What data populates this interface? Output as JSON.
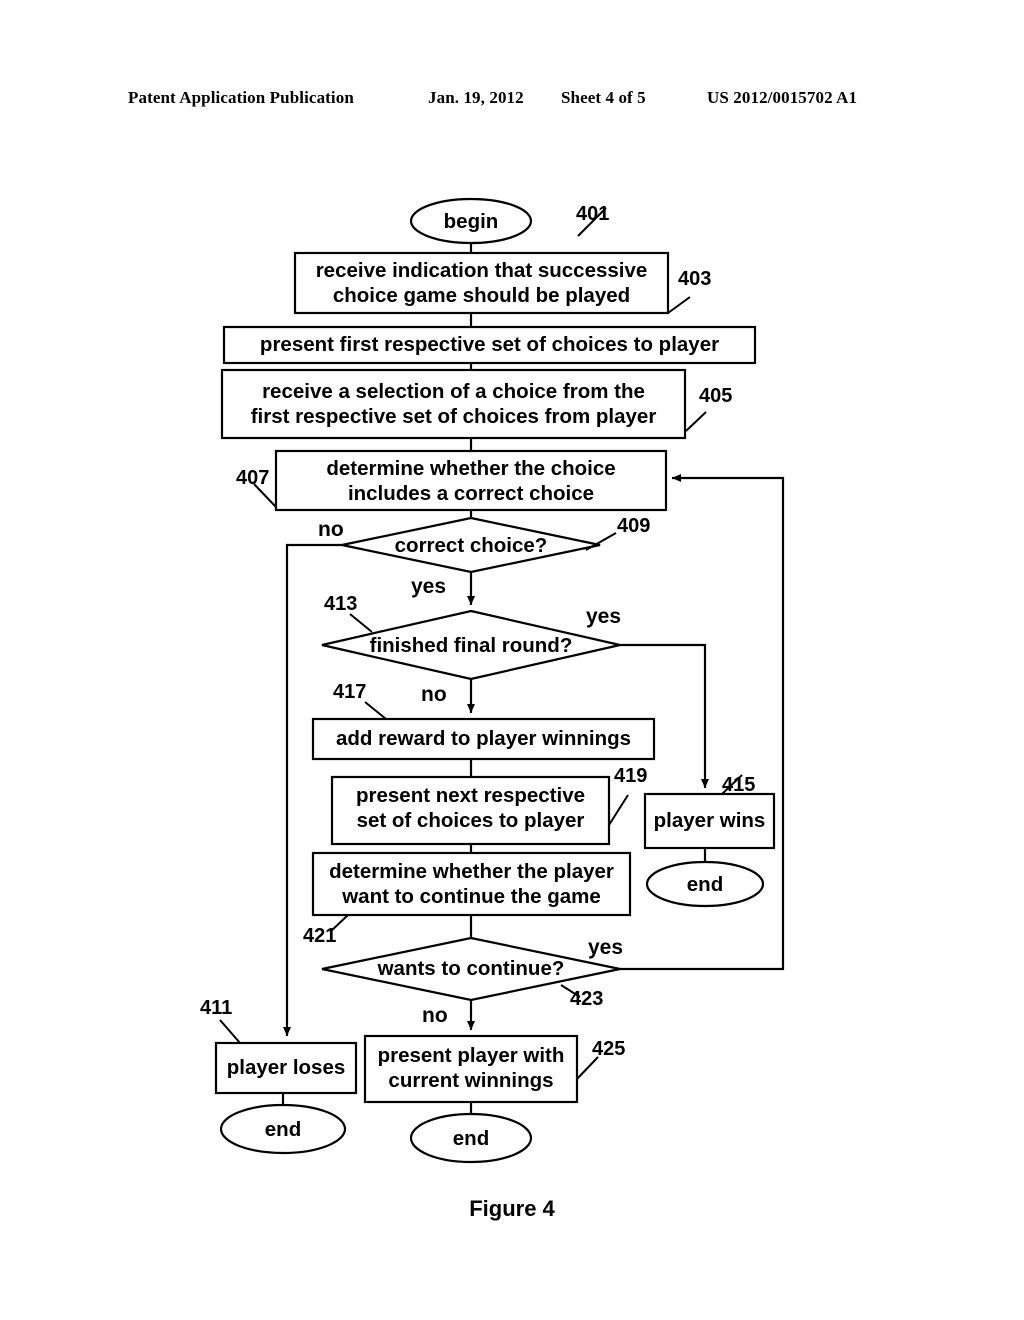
{
  "header": {
    "publication": "Patent Application Publication",
    "date": "Jan. 19, 2012",
    "sheet": "Sheet 4 of 5",
    "patent_number": "US 2012/0015702 A1"
  },
  "figure": {
    "caption": "Figure 4"
  },
  "flowchart": {
    "nodes": [
      {
        "id": "begin",
        "shape": "ellipse",
        "label": "begin"
      },
      {
        "id": "n403",
        "shape": "process",
        "label": "receive indication that successive\nchoice game should be played"
      },
      {
        "id": "n_present1",
        "shape": "process",
        "label": "present first respective set of choices to player"
      },
      {
        "id": "n405",
        "shape": "process",
        "label": "receive a selection of a choice from the\nfirst respective set of choices from player"
      },
      {
        "id": "n407",
        "shape": "process",
        "label": "determine whether the choice\nincludes a correct choice"
      },
      {
        "id": "n409",
        "shape": "decision",
        "label": "correct choice?"
      },
      {
        "id": "n413",
        "shape": "decision",
        "label": "finished final round?"
      },
      {
        "id": "n417",
        "shape": "process",
        "label": "add reward to player winnings"
      },
      {
        "id": "n419",
        "shape": "process",
        "label": "present next respective\nset of choices to player"
      },
      {
        "id": "n421",
        "shape": "process",
        "label": "determine whether the player\nwant to continue the game"
      },
      {
        "id": "n423",
        "shape": "decision",
        "label": "wants to continue?"
      },
      {
        "id": "n415",
        "shape": "process",
        "label": "player wins"
      },
      {
        "id": "n411",
        "shape": "process",
        "label": "player loses"
      },
      {
        "id": "n425",
        "shape": "process",
        "label": "present player with\ncurrent winnings"
      },
      {
        "id": "end_wins",
        "shape": "ellipse",
        "label": "end"
      },
      {
        "id": "end_loses",
        "shape": "ellipse",
        "label": "end"
      },
      {
        "id": "end_winnings",
        "shape": "ellipse",
        "label": "end"
      }
    ],
    "reference_numbers": [
      {
        "id": "ref401",
        "text": "401"
      },
      {
        "id": "ref403",
        "text": "403"
      },
      {
        "id": "ref405",
        "text": "405"
      },
      {
        "id": "ref407",
        "text": "407"
      },
      {
        "id": "ref409",
        "text": "409"
      },
      {
        "id": "ref411",
        "text": "411"
      },
      {
        "id": "ref413",
        "text": "413"
      },
      {
        "id": "ref415",
        "text": "415"
      },
      {
        "id": "ref417",
        "text": "417"
      },
      {
        "id": "ref419",
        "text": "419"
      },
      {
        "id": "ref421",
        "text": "421"
      },
      {
        "id": "ref423",
        "text": "423"
      },
      {
        "id": "ref425",
        "text": "425"
      }
    ],
    "edge_labels": [
      {
        "id": "edge-409-no",
        "text": "no"
      },
      {
        "id": "edge-409-yes",
        "text": "yes"
      },
      {
        "id": "edge-413-yes",
        "text": "yes"
      },
      {
        "id": "edge-413-no",
        "text": "no"
      },
      {
        "id": "edge-423-yes",
        "text": "yes"
      },
      {
        "id": "edge-423-no",
        "text": "no"
      }
    ],
    "colors": {
      "stroke": "#000000",
      "fill": "#ffffff",
      "background": "#ffffff"
    }
  }
}
